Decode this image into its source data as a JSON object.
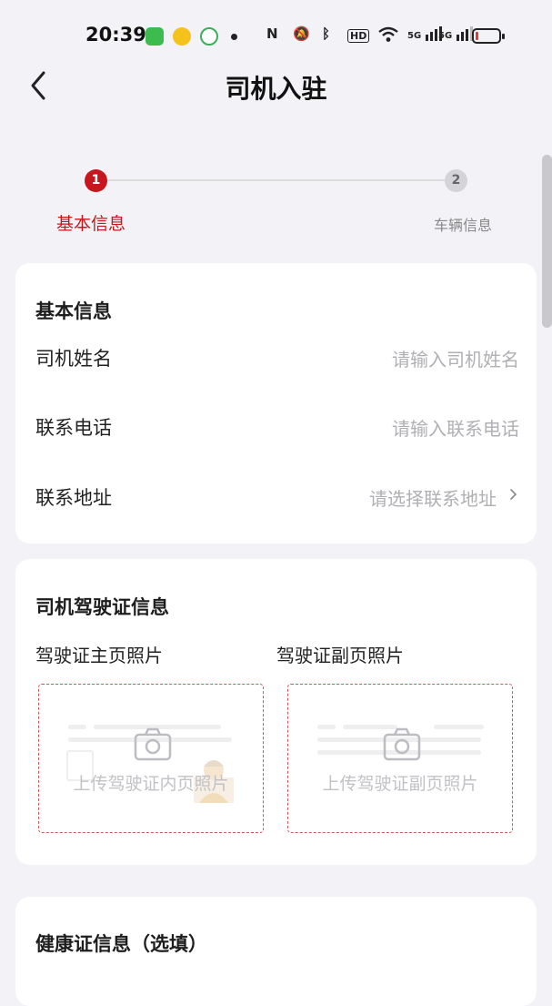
{
  "status_bar": {
    "time": "20:39",
    "signal_1": "5G",
    "signal_2": "5G",
    "hd_badge": "HD"
  },
  "nav": {
    "title": "司机入驻"
  },
  "steps": [
    {
      "number": "1",
      "label": "基本信息",
      "active": true
    },
    {
      "number": "2",
      "label": "车辆信息",
      "active": false
    }
  ],
  "basic_info": {
    "title": "基本信息",
    "fields": [
      {
        "label": "司机姓名",
        "placeholder": "请输入司机姓名"
      },
      {
        "label": "联系电话",
        "placeholder": "请输入联系电话"
      },
      {
        "label": "联系地址",
        "placeholder": "请选择联系地址"
      }
    ]
  },
  "license_info": {
    "title": "司机驾驶证信息",
    "front_label": "驾驶证主页照片",
    "back_label": "驾驶证副页照片",
    "front_upload_text": "上传驾驶证内页照片",
    "back_upload_text": "上传驾驶证副页照片"
  },
  "health_info": {
    "title": "健康证信息（选填）"
  },
  "colors": {
    "accent": "#c8161d",
    "background": "#f3f3f7",
    "placeholder": "#b0b0b4"
  }
}
